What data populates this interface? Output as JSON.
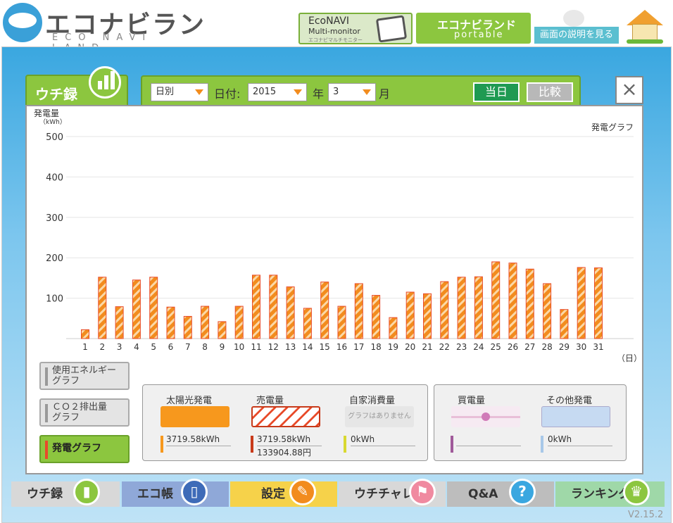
{
  "brand": {
    "title": "エコナビランド",
    "subtitle": "ECO NAVI LAND"
  },
  "header": {
    "econavi_line1": "EcoNAVI",
    "econavi_line2": "Multi-monitor",
    "econavi_line3": "エコナビマルチモニター",
    "portable_line1": "エコナビランド",
    "portable_line2": "portable",
    "help_label": "画面の説明を見る"
  },
  "tab": {
    "label": "ウチ録"
  },
  "filter": {
    "mode": "日別",
    "date_label": "日付:",
    "year": "2015",
    "year_unit": "年",
    "month": "3",
    "month_unit": "月",
    "today_label": "当日",
    "compare_label": "比較"
  },
  "close_label": "×",
  "side_buttons": [
    {
      "line1": "使用エネルギー",
      "line2": "グラフ"
    },
    {
      "line1": "ＣＯ２排出量",
      "line2": "グラフ"
    },
    {
      "line1": "発電グラフ",
      "line2": ""
    }
  ],
  "legend": {
    "solar": {
      "label": "太陽光発電",
      "value": "3719.58kWh"
    },
    "sell": {
      "label": "売電量",
      "value": "3719.58kWh",
      "value2": "133904.88円"
    },
    "self": {
      "label": "自家消費量",
      "note": "グラフはありません",
      "value": "0kWh"
    },
    "buy": {
      "label": "買電量"
    },
    "other": {
      "label": "その他発電",
      "value": "0kWh"
    }
  },
  "nav": [
    {
      "label": "ウチ録",
      "color": "#d8d8d8",
      "icon_color": "#8cc63f",
      "icon": "bar-chart"
    },
    {
      "label": "エコ帳",
      "color": "#8fa8d8",
      "icon_color": "#3e6bb8",
      "icon": "notebook"
    },
    {
      "label": "設定",
      "color": "#f6d24a",
      "icon_color": "#f28c1e",
      "icon": "wrench"
    },
    {
      "label": "ウチチャレ",
      "color": "#d8d8d8",
      "icon_color": "#f08aa0",
      "icon": "flag"
    },
    {
      "label": "Q&A",
      "color": "#bdbdbd",
      "icon_color": "#3aa7e0",
      "icon": "question"
    },
    {
      "label": "ランキング",
      "color": "#9fd8a8",
      "icon_color": "#8cc63f",
      "icon": "crown"
    }
  ],
  "version": "V2.15.2",
  "chart_data": {
    "type": "bar",
    "title": "発電グラフ",
    "ylabel": "発電量",
    "yunit": "（kWh）",
    "xlabel": "（日）",
    "ylim": [
      0,
      500
    ],
    "yticks": [
      100,
      200,
      300,
      400,
      500
    ],
    "categories": [
      "1",
      "2",
      "3",
      "4",
      "5",
      "6",
      "7",
      "8",
      "9",
      "10",
      "11",
      "12",
      "13",
      "14",
      "15",
      "16",
      "17",
      "18",
      "19",
      "20",
      "21",
      "22",
      "23",
      "24",
      "25",
      "26",
      "27",
      "28",
      "29",
      "30",
      "31"
    ],
    "values": [
      22,
      152,
      79,
      145,
      152,
      78,
      55,
      80,
      42,
      80,
      157,
      157,
      128,
      75,
      140,
      80,
      136,
      107,
      52,
      115,
      111,
      141,
      152,
      153,
      190,
      187,
      172,
      136,
      72,
      176,
      175
    ],
    "series_color": "#f28c1e",
    "hatch_color": "#e84b2a"
  }
}
